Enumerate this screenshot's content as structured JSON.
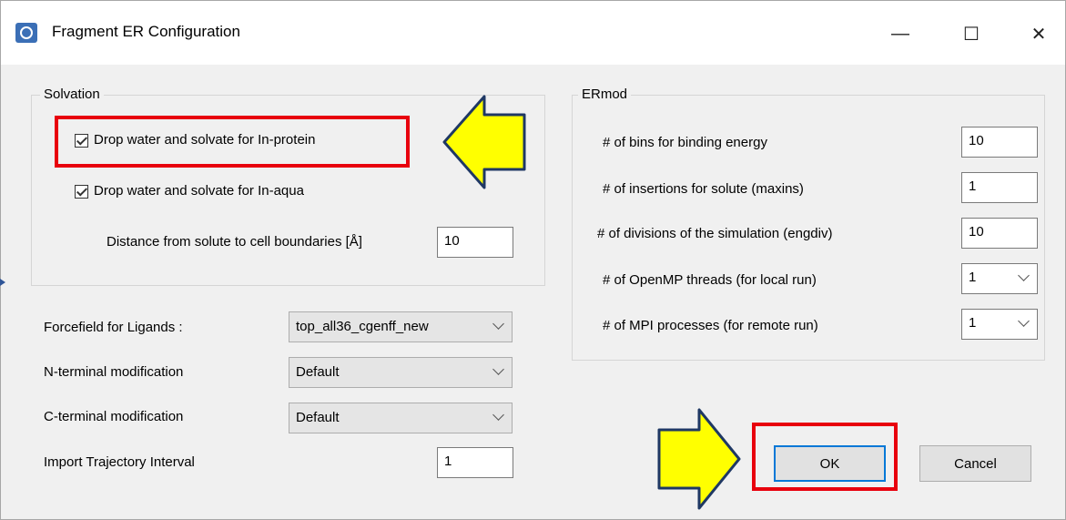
{
  "window": {
    "title": "Fragment ER Configuration",
    "minimize_glyph": "—",
    "maximize_glyph": "☐",
    "close_glyph": "✕"
  },
  "solvation": {
    "group_label": "Solvation",
    "in_protein_label": "Drop water and solvate for In-protein",
    "in_protein_checked": true,
    "in_aqua_label": "Drop water and solvate for In-aqua",
    "in_aqua_checked": true,
    "distance_label": "Distance from solute to cell boundaries [Å]",
    "distance_value": "10"
  },
  "settings": {
    "forcefield_label": "Forcefield for Ligands :",
    "forcefield_value": "top_all36_cgenff_new",
    "nterm_label": "N-terminal modification",
    "nterm_value": "Default",
    "cterm_label": "C-terminal modification",
    "cterm_value": "Default",
    "traj_label": "Import Trajectory Interval",
    "traj_value": "1"
  },
  "ermod": {
    "group_label": "ERmod",
    "bins_label": "# of bins for binding energy",
    "bins_value": "10",
    "insertions_label": "# of insertions for solute (maxins)",
    "insertions_value": "1",
    "divisions_label": "# of divisions of the simulation (engdiv)",
    "divisions_value": "10",
    "omp_label": "# of OpenMP threads (for local run)",
    "omp_value": "1",
    "mpi_label": "# of MPI processes (for remote run)",
    "mpi_value": "1"
  },
  "buttons": {
    "ok_label": "OK",
    "cancel_label": "Cancel"
  },
  "colors": {
    "highlight_red": "#e8000d",
    "arrow_yellow": "#ffff00",
    "arrow_outline": "#1f3864",
    "default_button_border": "#0078d7"
  }
}
